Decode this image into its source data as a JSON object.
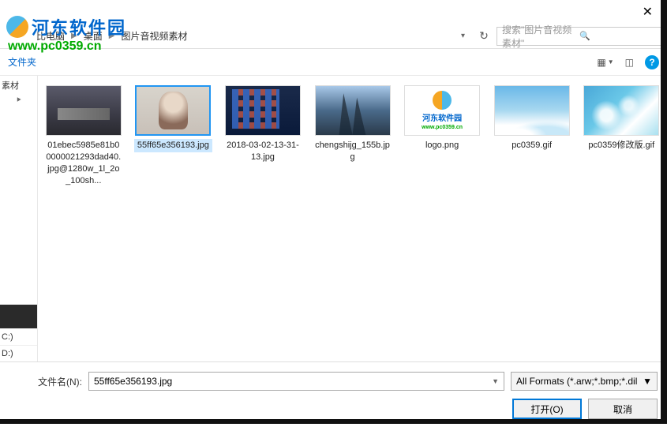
{
  "breadcrumb": {
    "item1": "比电脑",
    "item2": "桌面",
    "item3": "图片音视频素材"
  },
  "search": {
    "placeholder": "搜索\"图片音视频素材\""
  },
  "toolbar": {
    "folder_label": "文件夹"
  },
  "sidebar": {
    "top_label": "素材",
    "drive_c": "C:)",
    "drive_d": "D:)"
  },
  "watermark": {
    "brand": "河东软件园",
    "url": "www.pc0359.cn",
    "logo_brand_small": "河东软件园",
    "logo_url_small": "www.pc0359.cn"
  },
  "files": [
    {
      "name": "01ebec5985e81b00000021293dad40.jpg@1280w_1l_2o_100sh..."
    },
    {
      "name": "55ff65e356193.jpg"
    },
    {
      "name": "2018-03-02-13-31-13.jpg"
    },
    {
      "name": "chengshijg_155b.jpg"
    },
    {
      "name": "logo.png"
    },
    {
      "name": "pc0359.gif"
    },
    {
      "name": "pc0359修改版.gif"
    }
  ],
  "footer": {
    "filename_label": "文件名(N):",
    "filename_value": "55ff65e356193.jpg",
    "format_label": "All Formats (*.arw;*.bmp;*.dil",
    "open_label": "打开(O)",
    "cancel_label": "取消"
  }
}
